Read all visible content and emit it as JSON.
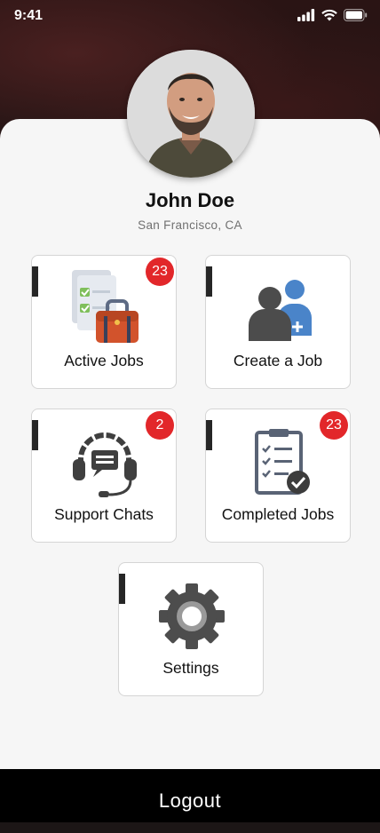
{
  "status": {
    "time": "9:41"
  },
  "profile": {
    "name": "John Doe",
    "location": "San Francisco, CA"
  },
  "tiles": [
    {
      "label": "Active Jobs",
      "badge": "23",
      "icon": "briefcase-checklist-icon"
    },
    {
      "label": "Create a Job",
      "badge": "",
      "icon": "add-user-icon"
    },
    {
      "label": "Support Chats",
      "badge": "2",
      "icon": "headset-chat-icon"
    },
    {
      "label": "Completed Jobs",
      "badge": "23",
      "icon": "clipboard-check-icon"
    },
    {
      "label": "Settings",
      "badge": "",
      "icon": "gear-icon"
    }
  ],
  "footer": {
    "logout_label": "Logout"
  },
  "colors": {
    "badge": "#e2272a",
    "accent_tab": "#262626",
    "footer": "#000000"
  }
}
